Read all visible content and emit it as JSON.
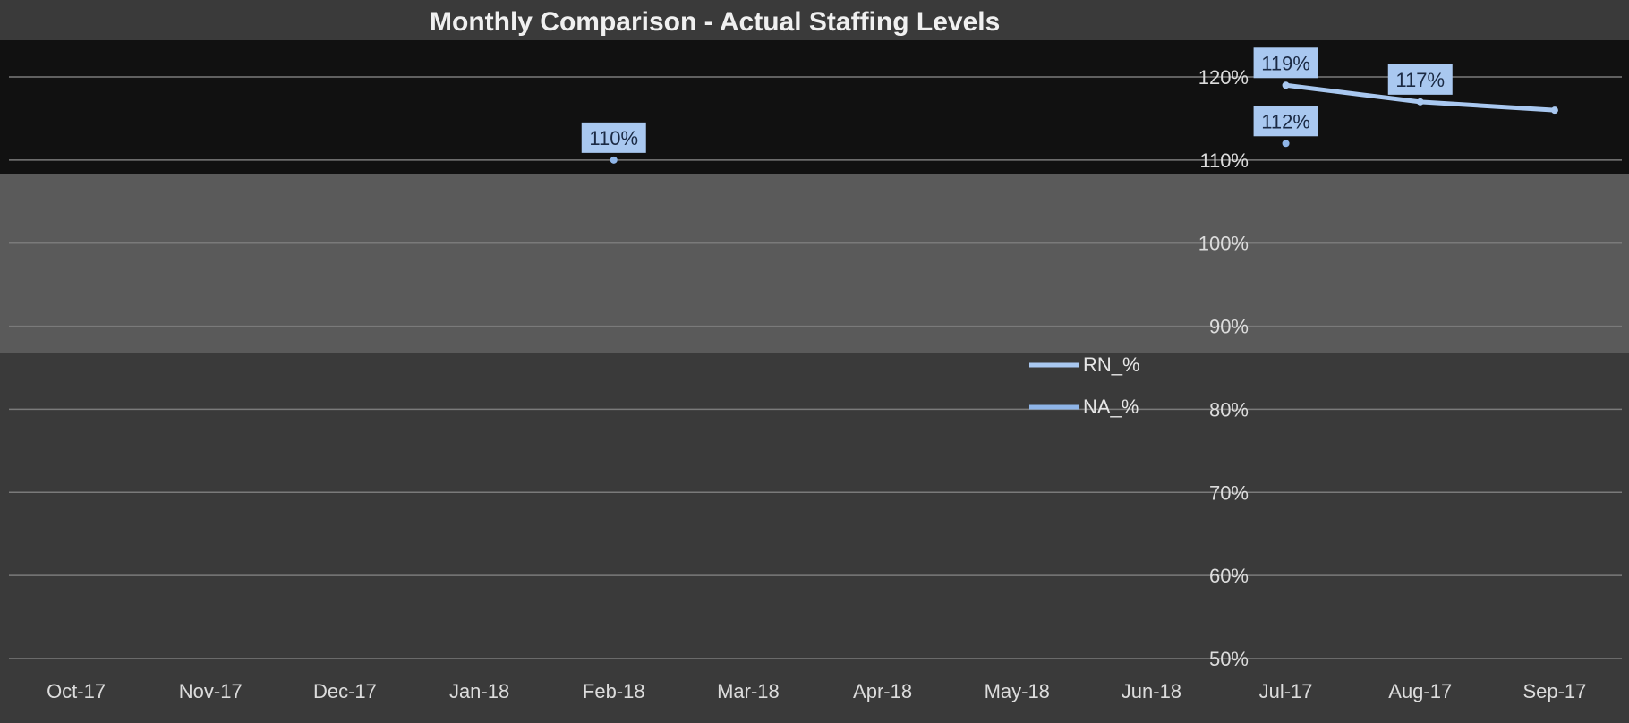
{
  "chart_data": {
    "type": "line",
    "title": "Monthly Comparison - Actual Staffing Levels",
    "categories": [
      "Oct-17",
      "Nov-17",
      "Dec-17",
      "Jan-18",
      "Feb-18",
      "Mar-18",
      "Apr-18",
      "May-18",
      "Jun-18",
      "Jul-17",
      "Aug-17",
      "Sep-17"
    ],
    "ylim": [
      50,
      120
    ],
    "yticks": [
      "50%",
      "60%",
      "70%",
      "80%",
      "90%",
      "100%",
      "110%",
      "120%"
    ],
    "series": [
      {
        "name": "RN_%",
        "color": "#a9c8f0",
        "values": [
          null,
          null,
          null,
          null,
          null,
          null,
          null,
          null,
          null,
          119,
          117,
          116
        ]
      },
      {
        "name": "NA_%",
        "color": "#8fb5e8",
        "values": [
          null,
          null,
          null,
          null,
          110,
          null,
          null,
          null,
          null,
          112,
          null,
          null
        ]
      }
    ],
    "data_labels": [
      {
        "series": 0,
        "index": 9,
        "text": "119%"
      },
      {
        "series": 0,
        "index": 10,
        "text": "117%"
      },
      {
        "series": 1,
        "index": 4,
        "text": "110%"
      },
      {
        "series": 1,
        "index": 9,
        "text": "112%"
      }
    ],
    "grid": true,
    "legend_position": "right"
  },
  "labels": {
    "legend": [
      "RN_%",
      "NA_%"
    ]
  }
}
